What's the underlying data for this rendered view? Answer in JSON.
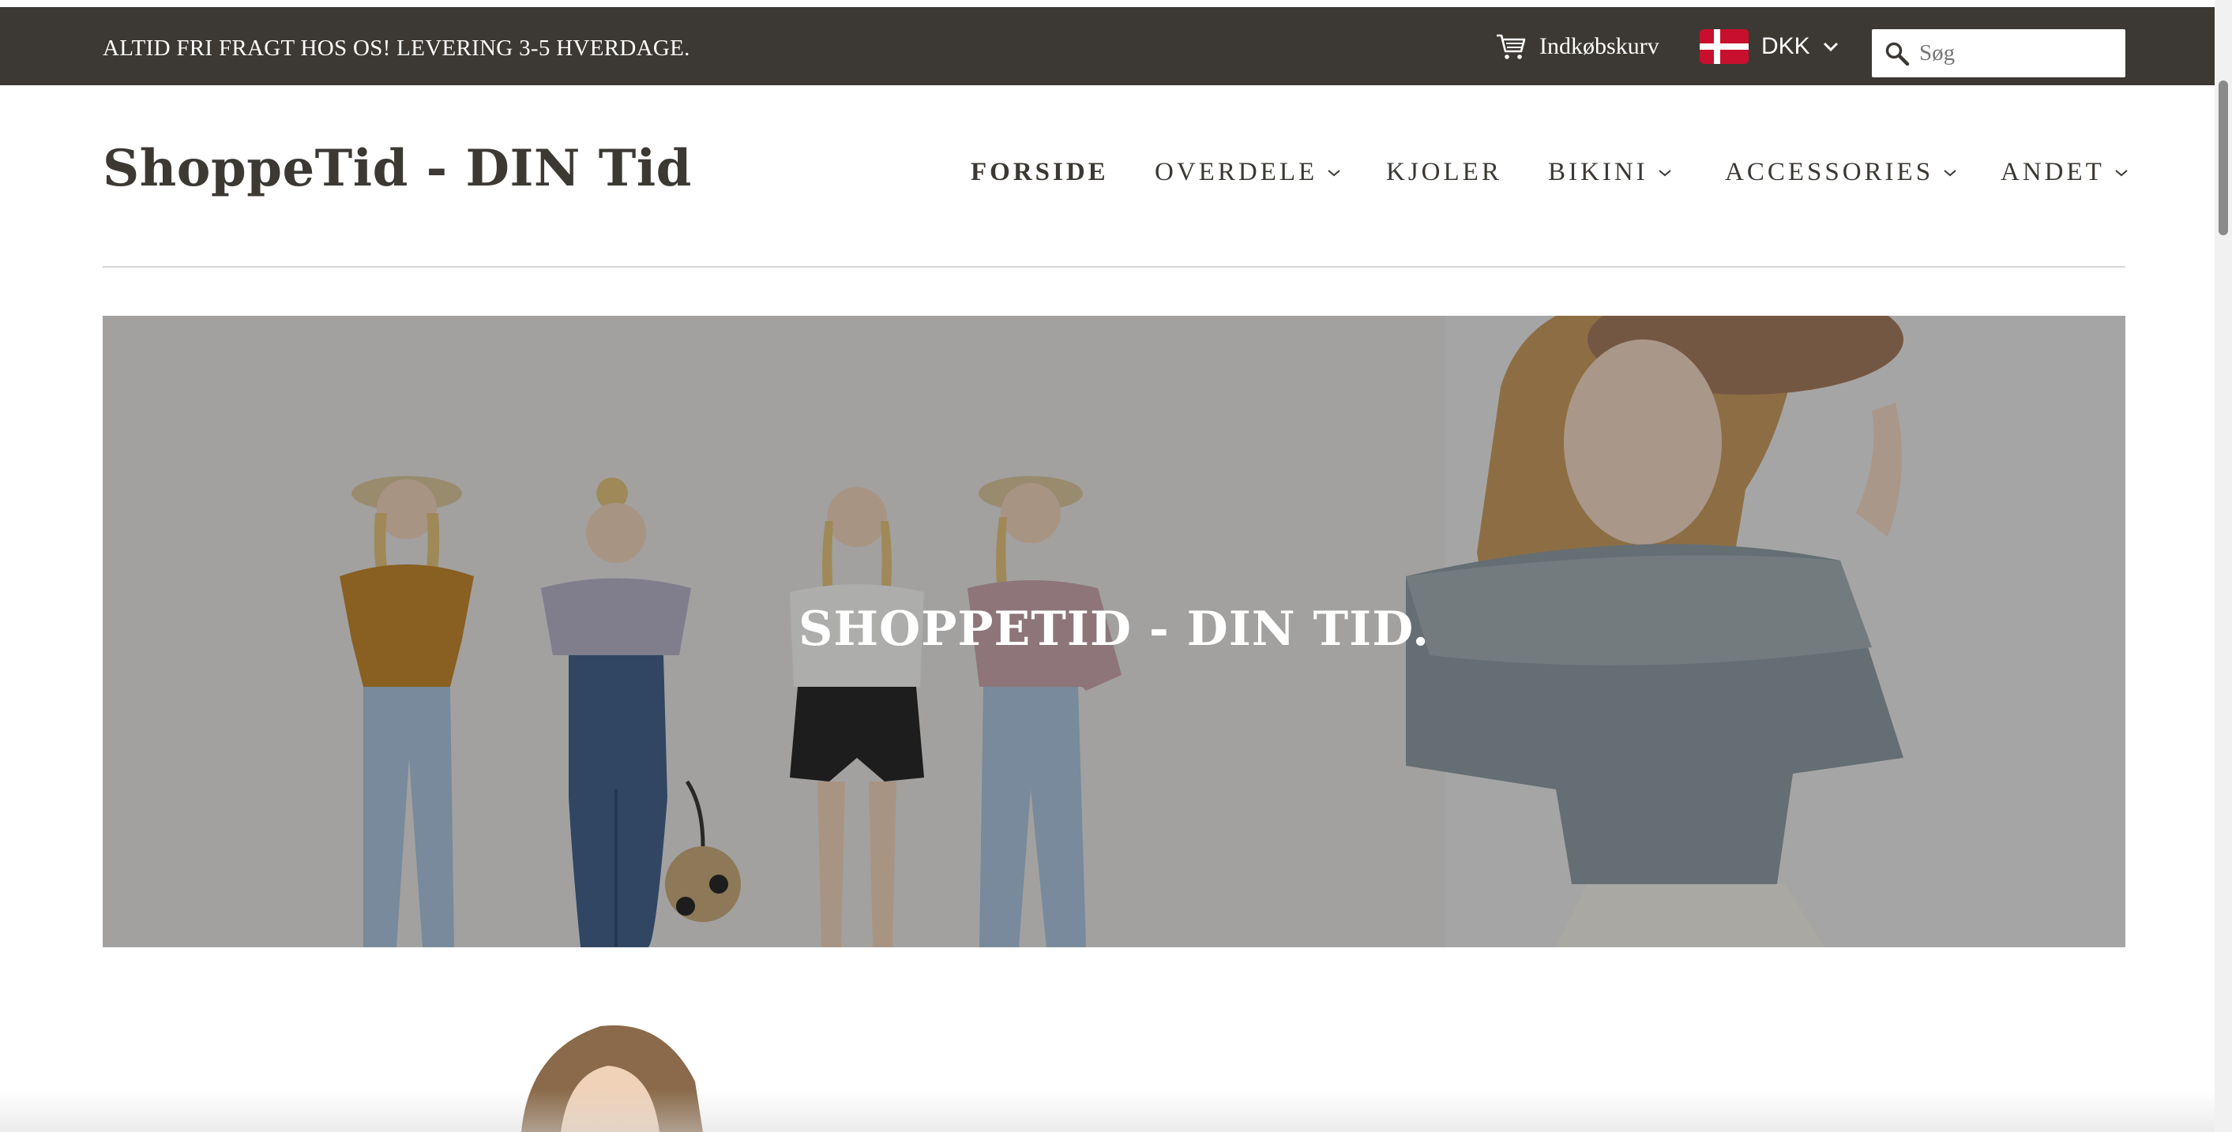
{
  "announcement": "ALTID FRI FRAGT HOS OS! LEVERING 3-5 HVERDAGE.",
  "cart": {
    "label": "Indkøbskurv",
    "icon": "cart-icon"
  },
  "currency": {
    "selected": "DKK",
    "flag": "denmark-flag-icon"
  },
  "search": {
    "placeholder": "Søg",
    "icon": "search-icon"
  },
  "site_title": "ShoppeTid - DIN Tid",
  "nav": {
    "items": [
      {
        "label": "FORSIDE",
        "active": true,
        "dropdown": false
      },
      {
        "label": "OVERDELE",
        "active": false,
        "dropdown": true
      },
      {
        "label": "KJOLER",
        "active": false,
        "dropdown": false
      },
      {
        "label": "BIKINI",
        "active": false,
        "dropdown": true
      },
      {
        "label": "ACCESSORIES",
        "active": false,
        "dropdown": true
      },
      {
        "label": "ANDET",
        "active": false,
        "dropdown": true
      }
    ]
  },
  "hero": {
    "title": "SHOPPETID - DIN TID."
  },
  "colors": {
    "topbar_bg": "#3c3934",
    "text_dark": "#3c3934",
    "flag_red": "#c8102e",
    "divider": "#d6d6d6"
  }
}
